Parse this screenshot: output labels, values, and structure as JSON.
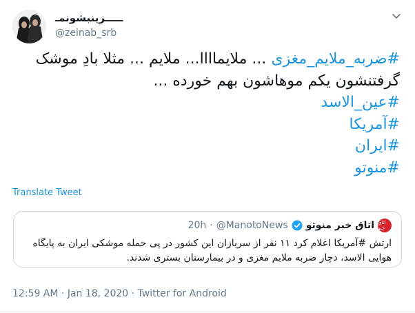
{
  "user": {
    "display_name": "ـــــزینبشونمـ",
    "handle": "@zeinab_srb"
  },
  "tweet": {
    "line1_hashtag": "#ضربه_ملایم_مغزی",
    "line1_text": " ... ملایماااا... ملایم ... مثلا بادِ موشک",
    "line2_text": "گرفتنشون یکم موهاشون بهم خورده ...",
    "hashtags": [
      "#عین_الاسد",
      "#آمریکا",
      "#ایران",
      "#منوتو"
    ]
  },
  "translate_label": "Translate Tweet",
  "quote": {
    "avatar_text": "اتاق خبر",
    "name": "اتاق خبر منوتو",
    "handle": "@ManotoNews",
    "separator": "·",
    "time": "20h",
    "text_line1": "ارتش #آمریکا اعلام کرد ۱۱ نفر از سربازان این کشور در پی حمله موشکی ایران به پایگاه",
    "text_line2": "هوایی الاسد، دچار ضربه ملایم مغزی و در بیمارستان بستری شدند."
  },
  "meta": {
    "time": "12:59 AM",
    "separator1": " · ",
    "date": "Jan 18, 2020",
    "separator2": " · ",
    "source": "Twitter for Android"
  },
  "colors": {
    "link": "#1b95e0",
    "verified": "#1da1f2",
    "muted": "#657786"
  }
}
